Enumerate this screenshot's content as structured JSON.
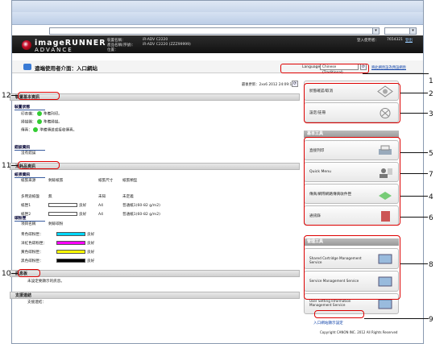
{
  "header": {
    "brand_line1": "imageRUNNER",
    "brand_line2": "ADVANCE",
    "device_name_label": "裝置名稱：",
    "device_name": "iR-ADV C2220",
    "product_name_label": "產品名稱(序號)：",
    "product_name": "iR-ADV C2220 (ZZZ99999)",
    "location_label": "位置：",
    "login_user_label": "登入使用者：",
    "login_user": "7654321",
    "logout": "登出"
  },
  "subheader": {
    "title": "遠端使用者介面：入口網站",
    "language_label": "Language:",
    "language_value": "Chinese (Traditional)",
    "set_default": "將此網頁設為預設網頁"
  },
  "last_update": "最後更新：2xx6 2012 24:09:19",
  "device_basic": {
    "title": "裝置基本資訊",
    "status_sub": "裝置狀態",
    "rows": [
      {
        "label": "印表機：",
        "value": "準備列印。"
      },
      {
        "label": "掃描器：",
        "value": "準備掃描。"
      },
      {
        "label": "傳真：",
        "value": "準備傳送或接收傳真。"
      }
    ],
    "error_sub": "錯誤資訊",
    "error_text": "沒有錯誤"
  },
  "consumables": {
    "title": "消耗品資訊",
    "paper_sub": "紙張資訊",
    "paper_headers": [
      "紙張來源",
      "剩餘紙張",
      "紙張尺寸",
      "紙張類型"
    ],
    "paper_rows": [
      {
        "src": "多用途紙盤",
        "level": "無",
        "size": "未知",
        "type": "未定義"
      },
      {
        "src": "紙匣1",
        "level": "良好",
        "size": "A4",
        "type": "普通紙1(60-82 g/m2)"
      },
      {
        "src": "紙匣2",
        "level": "良好",
        "size": "A4",
        "type": "普通紙1(60-82 g/m2)"
      }
    ],
    "paper_fill": [
      0,
      1,
      1
    ],
    "toner_sub": "碳粉匣",
    "toner_headers": [
      "項目名稱",
      "剩餘碳粉"
    ],
    "toner_rows": [
      {
        "name": "青色碳粉匣：",
        "level": "良好",
        "color": "#00d8ff"
      },
      {
        "name": "洋紅色碳粉匣：",
        "level": "良好",
        "color": "#ff00ff"
      },
      {
        "name": "黃色碳粉匣：",
        "level": "良好",
        "color": "#ffff00"
      },
      {
        "name": "黑色碳粉匣：",
        "level": "良好",
        "color": "#000000"
      }
    ]
  },
  "message_board": {
    "title": "訊息板",
    "text": "未設定要顯示的訊息。"
  },
  "support": {
    "title": "支援連結",
    "text": "支援連結："
  },
  "right": {
    "buttons_top": [
      "狀態確認/取消",
      "設定/註冊"
    ],
    "basic_tools_title": "基本工具",
    "basic_tools": [
      "直接列印",
      "Quick Menu",
      "傳真/網際網路傳真收件匣",
      "通訊錄"
    ],
    "mgmt_title": "管理工具",
    "mgmt_tools": [
      "Shared Cartridge Management Service",
      "Service Management Service",
      "User Setting Information Management Service"
    ],
    "portal_display": "入口網站顯示設定",
    "copyright": "Copyright CANON INC. 2012 All Rights Reserved"
  },
  "callouts": [
    "1",
    "2",
    "3",
    "4",
    "5",
    "6",
    "7",
    "8",
    "9",
    "10",
    "11",
    "12"
  ]
}
